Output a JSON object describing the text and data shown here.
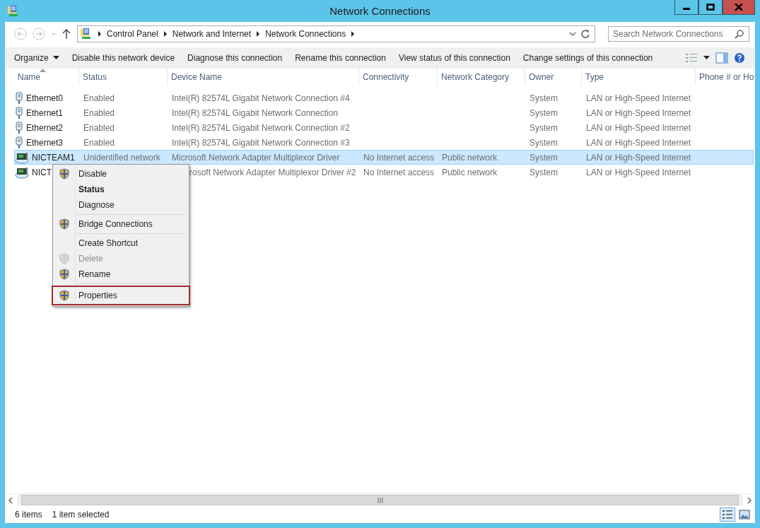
{
  "window": {
    "title": "Network Connections"
  },
  "address_bar": {
    "breadcrumbs": [
      "Control Panel",
      "Network and Internet",
      "Network Connections"
    ]
  },
  "search": {
    "placeholder": "Search Network Connections"
  },
  "toolbar": {
    "commands": [
      {
        "label": "Organize",
        "kind": "dropdown"
      },
      {
        "label": "Disable this network device",
        "kind": "command"
      },
      {
        "label": "Diagnose this connection",
        "kind": "command"
      },
      {
        "label": "Rename this connection",
        "kind": "command"
      },
      {
        "label": "View status of this connection",
        "kind": "command"
      },
      {
        "label": "Change settings of this connection",
        "kind": "command"
      }
    ]
  },
  "table": {
    "columns": [
      {
        "label": "Name",
        "sorted": true
      },
      {
        "label": "Status",
        "sorted": false
      },
      {
        "label": "Device Name",
        "sorted": false
      },
      {
        "label": "Connectivity",
        "sorted": false
      },
      {
        "label": "Network Category",
        "sorted": false
      },
      {
        "label": "Owner",
        "sorted": false
      },
      {
        "label": "Type",
        "sorted": false
      },
      {
        "label": "Phone # or Ho",
        "sorted": false
      }
    ],
    "rows": [
      {
        "kind": "ethernet",
        "selected": false,
        "under_menu": false,
        "cells": [
          "Ethernet0",
          "Enabled",
          "Intel(R) 82574L Gigabit Network Connection #4",
          "",
          "",
          "System",
          "LAN or High-Speed Internet"
        ]
      },
      {
        "kind": "ethernet",
        "selected": false,
        "under_menu": false,
        "cells": [
          "Ethernet1",
          "Enabled",
          "Intel(R) 82574L Gigabit Network Connection",
          "",
          "",
          "System",
          "LAN or High-Speed Internet"
        ]
      },
      {
        "kind": "ethernet",
        "selected": false,
        "under_menu": false,
        "cells": [
          "Ethernet2",
          "Enabled",
          "Intel(R) 82574L Gigabit Network Connection #2",
          "",
          "",
          "System",
          "LAN or High-Speed Internet"
        ]
      },
      {
        "kind": "ethernet",
        "selected": false,
        "under_menu": false,
        "cells": [
          "Ethernet3",
          "Enabled",
          "Intel(R) 82574L Gigabit Network Connection #3",
          "",
          "",
          "System",
          "LAN or High-Speed Internet"
        ]
      },
      {
        "kind": "team",
        "selected": true,
        "under_menu": false,
        "cells": [
          "NICTEAM1",
          "Unidentified network",
          "Microsoft Network Adapter Multiplexor Driver",
          "No Internet access",
          "Public network",
          "System",
          "LAN or High-Speed Internet"
        ]
      },
      {
        "kind": "team",
        "selected": false,
        "under_menu": true,
        "cells": [
          "NICT",
          "",
          "rosoft Network Adapter Multiplexor Driver #2",
          "No Internet access",
          "Public network",
          "System",
          "LAN or High-Speed Internet"
        ]
      }
    ]
  },
  "context_menu": {
    "items": [
      {
        "kind": "item",
        "label": "Disable",
        "shield": true,
        "bold": false,
        "disabled": false,
        "highlighted": false
      },
      {
        "kind": "item",
        "label": "Status",
        "shield": false,
        "bold": true,
        "disabled": false,
        "highlighted": false
      },
      {
        "kind": "item",
        "label": "Diagnose",
        "shield": false,
        "bold": false,
        "disabled": false,
        "highlighted": false
      },
      {
        "kind": "separator"
      },
      {
        "kind": "item",
        "label": "Bridge Connections",
        "shield": true,
        "bold": false,
        "disabled": false,
        "highlighted": false
      },
      {
        "kind": "separator"
      },
      {
        "kind": "item",
        "label": "Create Shortcut",
        "shield": false,
        "bold": false,
        "disabled": false,
        "highlighted": false
      },
      {
        "kind": "item",
        "label": "Delete",
        "shield": true,
        "bold": false,
        "disabled": true,
        "highlighted": false
      },
      {
        "kind": "item",
        "label": "Rename",
        "shield": true,
        "bold": false,
        "disabled": false,
        "highlighted": false
      },
      {
        "kind": "separator"
      },
      {
        "kind": "item",
        "label": "Properties",
        "shield": true,
        "bold": false,
        "disabled": false,
        "highlighted": true
      }
    ]
  },
  "status_bar": {
    "count": "6 items",
    "selection": "1 item selected",
    "views": [
      {
        "kind": "details",
        "selected": true
      },
      {
        "kind": "tiles",
        "selected": false
      }
    ]
  }
}
